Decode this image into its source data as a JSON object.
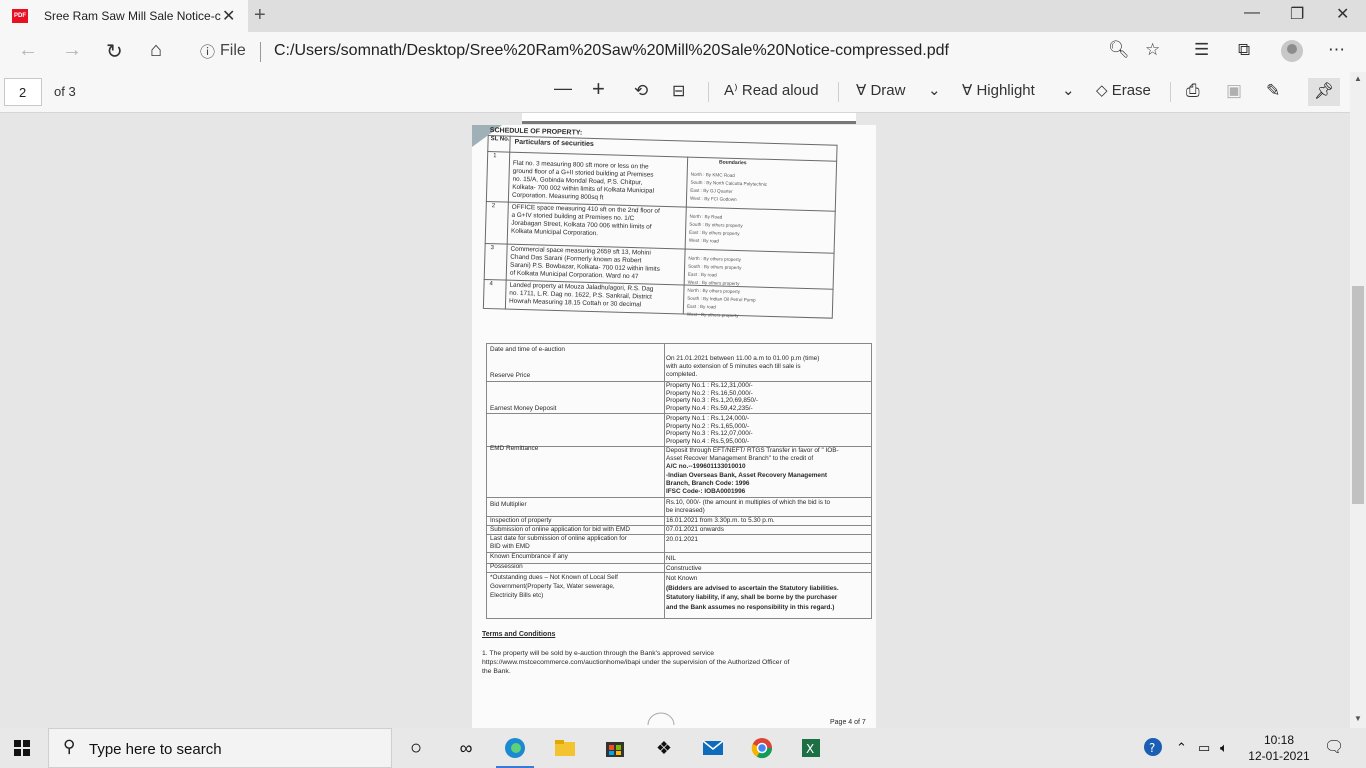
{
  "browser": {
    "tab_title": "Sree Ram Saw Mill Sale Notice-c",
    "pdf_badge": "PDF",
    "file_label": "File",
    "url": "C:/Users/somnath/Desktop/Sree%20Ram%20Saw%20Mill%20Sale%20Notice-compressed.pdf"
  },
  "pdf_toolbar": {
    "page_number": "2",
    "page_total": "of 3",
    "read_aloud": "Read aloud",
    "draw": "Draw",
    "highlight": "Highlight",
    "erase": "Erase"
  },
  "document": {
    "schedule_title": "SCHEDULE OF PROPERTY:",
    "col_sl": "SL No.",
    "col_particulars": "Particulars of securities",
    "col_boundaries": "Boundaries",
    "properties": [
      {
        "sl": "1",
        "lines": [
          "Flat no. 3 measuring 800 sft more or less on the",
          "ground floor of a G+II storied building at Premises",
          "no. 15/A, Gobinda Mondal Road, P.S. Chitpur,",
          "Kolkata- 700 002 within limits of Kolkata Municipal",
          "Corporation. Measuring 800sq ft"
        ],
        "bounds": [
          "North : By KMC Road",
          "South : By North Calcutta Polytechnic",
          "East : By GJ Quarter",
          "West : By FCI Godown"
        ]
      },
      {
        "sl": "2",
        "lines": [
          "OFFICE space measuring 410 sft on the 2nd floor of",
          "a G+IV storied building at Premises no. 1/C",
          "Jorabagan Street, Kolkata 700 006 within limits of",
          "Kolkata Municipal Corporation."
        ],
        "bounds": [
          "North : By Road",
          "South : By others property",
          "East : By others property",
          "West : By road"
        ]
      },
      {
        "sl": "3",
        "lines": [
          "Commercial space measuring 2659 sft 13, Mohini",
          "Chand Das Sarani (Formerly known as Robert",
          "Sarani) P.S. Bowbazar, Kolkata- 700 012 within limits",
          "of Kolkata Municipal Corporation. Ward no 47"
        ],
        "bounds": [
          "North : By others property",
          "South : By others property",
          "East : By road",
          "West : By others property"
        ]
      },
      {
        "sl": "4",
        "lines": [
          "Landed property at Mouza Jaladhulagori, R.S. Dag",
          "no. 1711, L.R. Dag no. 1622, P.S. Sankrail, District",
          "Howrah Measuring 18.15 Cottah or 30 decimal"
        ],
        "bounds": [
          "North : By others property",
          "South : By Indian Oil Petrol Pump",
          "East : By road",
          "West : By others property"
        ]
      }
    ],
    "auction_rows": [
      {
        "label": [
          "Date and time of e-auction"
        ],
        "value": [
          "On 21.01.2021 between 11.00 a.m to 01.00 p.m (time)",
          "with auto extension of 5 minutes each till sale is",
          "completed."
        ]
      },
      {
        "label": [
          "Reserve Price"
        ],
        "value": [
          "Property No.1 : Rs.12,31,000/-",
          "Property No.2 : Rs.16,50,000/-",
          "Property No.3 : Rs.1,20,69,850/-",
          "Property No.4 : Rs.59,42,235/-"
        ]
      },
      {
        "label": [
          "Earnest Money Deposit"
        ],
        "value": [
          "Property No.1 : Rs.1,24,000/-",
          "Property No.2 : Rs.1,65,000/-",
          "Property No.3 : Rs.12,07,000/-",
          "Property No.4 : Rs.5,95,000/-"
        ]
      },
      {
        "label": [
          "EMD Remittance"
        ],
        "value": [
          "Deposit through EFT/NEFT/ RTGS Transfer in favor of \" IOB-",
          "Asset Recover Management Branch\" to the credit of",
          "A/C no.--199601133010010",
          "-Indian Overseas Bank, Asset Recovery Management",
          "Branch, Branch Code: 1996",
          "IFSC Code-: IOBA0001996"
        ]
      },
      {
        "label": [
          "Bid Multiplier"
        ],
        "value": [
          "Rs.10, 000/- (the amount in multiples of which the bid is to",
          "be increased)"
        ]
      },
      {
        "label": [
          "Inspection of property"
        ],
        "value": [
          "16.01.2021 from 3.30p.m. to 5.30 p.m."
        ]
      },
      {
        "label": [
          "Submission of online application for bid with EMD"
        ],
        "value": [
          "07.01.2021 onwards"
        ]
      },
      {
        "label": [
          "Last date for submission of online application for",
          "BID with EMD"
        ],
        "value": [
          "20.01.2021"
        ]
      },
      {
        "label": [
          "Known Encumbrance if any"
        ],
        "value": [
          "NIL"
        ]
      },
      {
        "label": [
          "Possession"
        ],
        "value": [
          "Constructive"
        ]
      },
      {
        "label": [
          "*Outstanding dues – Not Known of Local Self",
          "Government(Property Tax, Water sewerage,",
          "Electricity Bills etc)"
        ],
        "value": [
          "Not Known",
          "(Bidders are advised to ascertain the Statutory liabilities.",
          "Statutory liability, if any, shall be borne by the purchaser",
          "and the Bank assumes no responsibility in this regard.)"
        ]
      }
    ],
    "terms_title": "Terms and Conditions",
    "terms_lines": [
      "1.   The   property   will   be   sold   by   e-auction   through   the   Bank's   approved   service",
      "https://www.mstcecommerce.com/auctionhome/ibapi under the supervision of the Authorized Officer of",
      "the Bank."
    ],
    "page_footer": "Page 4 of 7"
  },
  "taskbar": {
    "search_placeholder": "Type here to search",
    "time": "10:18",
    "date": "12-01-2021"
  }
}
